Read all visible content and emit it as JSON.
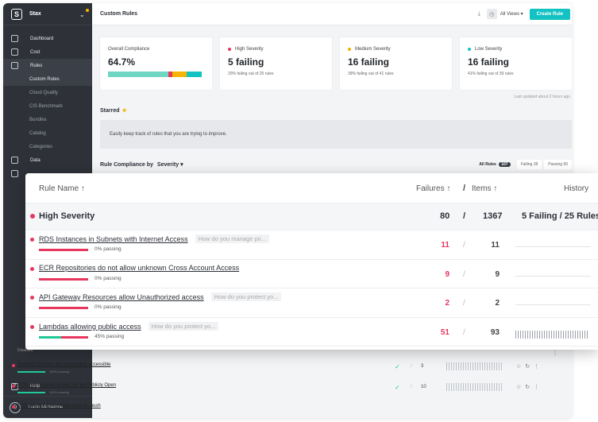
{
  "brand": {
    "name": "Stax"
  },
  "sidebar": {
    "items": [
      {
        "label": "Dashboard"
      },
      {
        "label": "Cost"
      },
      {
        "label": "Rules"
      }
    ],
    "subitems": [
      {
        "label": "Custom Rules"
      },
      {
        "label": "Cloud Quality"
      },
      {
        "label": "CIS Benchmark"
      },
      {
        "label": "Bundles"
      },
      {
        "label": "Catalog"
      },
      {
        "label": "Categories"
      }
    ],
    "data_label": "Data",
    "help_label": "Help",
    "user": {
      "initial": "D",
      "name": "Dario Michelone"
    }
  },
  "topbar": {
    "title": "Custom Rules",
    "views_label": "All Views",
    "create_label": "Create Rule"
  },
  "cards": [
    {
      "label": "Overall Compliance",
      "value": "64.7%",
      "colors": [
        "#6fd6c3",
        "#e8375e",
        "#f5b400",
        "#13c2c2"
      ],
      "segments": [
        0.64,
        0.05,
        0.15,
        0.16
      ]
    },
    {
      "label": "High Severity",
      "dot": "#e8375e",
      "value": "5 failing",
      "sub": "20% failing out of 25 rules"
    },
    {
      "label": "Medium Severity",
      "dot": "#f5b400",
      "value": "16 failing",
      "sub": "39% failing out of 41 rules"
    },
    {
      "label": "Low Severity",
      "dot": "#13c2c2",
      "value": "16 failing",
      "sub": "41% failing out of 39 rules"
    }
  ],
  "last_updated": "Last updated about 2 hours ago",
  "starred": {
    "title": "Starred",
    "hint": "Easily keep track of rules that you are trying to improve."
  },
  "compliance": {
    "title": "Rule Compliance by",
    "group_by": "Severity",
    "all_label": "All Rules",
    "all_count": "107",
    "failing_label": "Failing",
    "failing_count": "38",
    "passing_label": "Passing",
    "passing_count": "60"
  },
  "table": {
    "col_name": "Rule Name ↑",
    "col_failures": "Failures ↑",
    "col_slash": "/",
    "col_items": "Items ↑",
    "col_history": "History",
    "group": {
      "name": "High Severity",
      "failures": "80",
      "slash": "/",
      "items": "1367",
      "summary": "5 Failing / 25 Rules"
    },
    "rows": [
      {
        "name": "RDS Instances in Subnets with Internet Access",
        "question": "How do you manage pri...",
        "percent": 0,
        "pct_label": "0% passing",
        "failures": "11",
        "slash": "/",
        "items": "11"
      },
      {
        "name": "ECR Repositories do not allow unknown Cross Account Access",
        "question": "",
        "percent": 0,
        "pct_label": "0% passing",
        "failures": "9",
        "slash": "/",
        "items": "9"
      },
      {
        "name": "API Gateway Resources allow Unauthorized access",
        "question": "How do you protect yo...",
        "percent": 0,
        "pct_label": "0% passing",
        "failures": "2",
        "slash": "/",
        "items": "2"
      },
      {
        "name": "Lambdas allowing public access",
        "question": "How do you protect yo...",
        "percent": 45,
        "pct_label": "45% passing",
        "failures": "51",
        "slash": "/",
        "items": "93"
      }
    ]
  },
  "background_rows": {
    "disabled_label": "Disabled",
    "rows": [
      {
        "name": "Redshift Clusters are not publicly accessible",
        "pct_label": "100% passing",
        "items": "3"
      },
      {
        "name": "ECR Repositories should not be Publicly Open",
        "pct_label": "100% passing",
        "items": "10"
      },
      {
        "name": "ECR Repositories enable scan on push",
        "pct_label": "",
        "items": ""
      }
    ]
  }
}
